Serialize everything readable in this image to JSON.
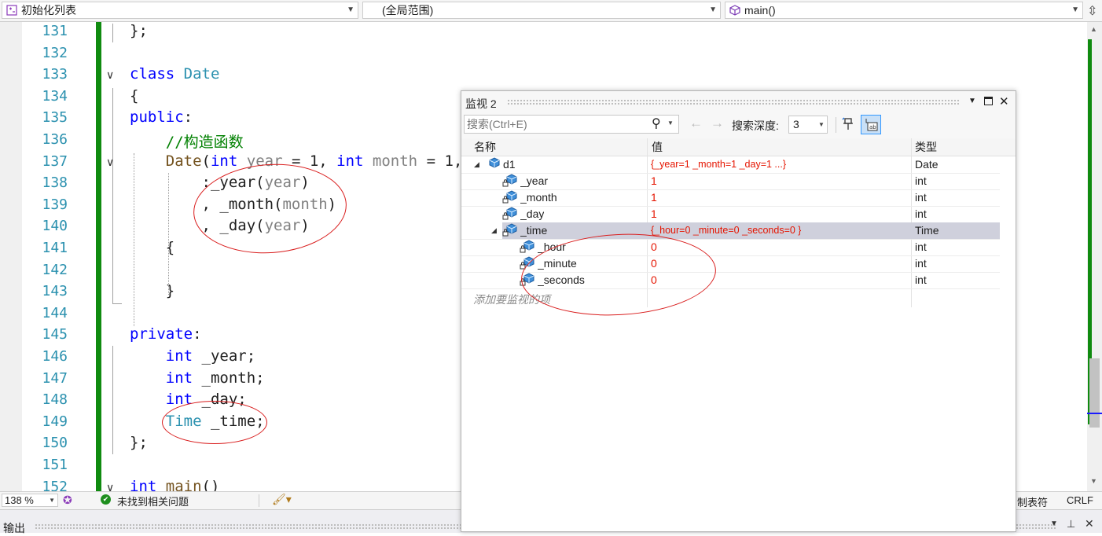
{
  "navbar": {
    "project": "初始化列表",
    "scope": "(全局范围)",
    "member": "main()"
  },
  "editor": {
    "lines": [
      {
        "num": "131",
        "segments": [
          {
            "t": "};",
            "c": ""
          }
        ]
      },
      {
        "num": "132",
        "segments": []
      },
      {
        "num": "133",
        "segments": [
          {
            "t": "class ",
            "c": "kw"
          },
          {
            "t": "Date",
            "c": "ty"
          }
        ]
      },
      {
        "num": "134",
        "segments": [
          {
            "t": "{",
            "c": ""
          }
        ]
      },
      {
        "num": "135",
        "segments": [
          {
            "t": "public",
            "c": "kw"
          },
          {
            "t": ":",
            "c": ""
          }
        ]
      },
      {
        "num": "136",
        "segments": [
          {
            "t": "    //构造函数",
            "c": "cm"
          }
        ]
      },
      {
        "num": "137",
        "segments": [
          {
            "t": "    ",
            "c": ""
          },
          {
            "t": "Date",
            "c": "fn"
          },
          {
            "t": "(",
            "c": ""
          },
          {
            "t": "int",
            "c": "kw"
          },
          {
            "t": " year",
            "c": "pm"
          },
          {
            "t": " = 1, ",
            "c": ""
          },
          {
            "t": "int",
            "c": "kw"
          },
          {
            "t": " month",
            "c": "pm"
          },
          {
            "t": " = 1,",
            "c": ""
          }
        ]
      },
      {
        "num": "138",
        "segments": [
          {
            "t": "        :_year(",
            "c": ""
          },
          {
            "t": "year",
            "c": "pm"
          },
          {
            "t": ")",
            "c": ""
          }
        ]
      },
      {
        "num": "139",
        "segments": [
          {
            "t": "        , _month(",
            "c": ""
          },
          {
            "t": "month",
            "c": "pm"
          },
          {
            "t": ")",
            "c": ""
          }
        ]
      },
      {
        "num": "140",
        "segments": [
          {
            "t": "        , _day(",
            "c": ""
          },
          {
            "t": "year",
            "c": "pm"
          },
          {
            "t": ")",
            "c": ""
          }
        ]
      },
      {
        "num": "141",
        "segments": [
          {
            "t": "    {",
            "c": ""
          }
        ]
      },
      {
        "num": "142",
        "segments": []
      },
      {
        "num": "143",
        "segments": [
          {
            "t": "    }",
            "c": ""
          }
        ]
      },
      {
        "num": "144",
        "segments": []
      },
      {
        "num": "145",
        "segments": [
          {
            "t": "private",
            "c": "kw"
          },
          {
            "t": ":",
            "c": ""
          }
        ]
      },
      {
        "num": "146",
        "segments": [
          {
            "t": "    ",
            "c": ""
          },
          {
            "t": "int",
            "c": "kw"
          },
          {
            "t": " _year;",
            "c": ""
          }
        ]
      },
      {
        "num": "147",
        "segments": [
          {
            "t": "    ",
            "c": ""
          },
          {
            "t": "int",
            "c": "kw"
          },
          {
            "t": " _month;",
            "c": ""
          }
        ]
      },
      {
        "num": "148",
        "segments": [
          {
            "t": "    ",
            "c": ""
          },
          {
            "t": "int",
            "c": "kw"
          },
          {
            "t": " _day;",
            "c": ""
          }
        ]
      },
      {
        "num": "149",
        "segments": [
          {
            "t": "    ",
            "c": ""
          },
          {
            "t": "Time",
            "c": "ty"
          },
          {
            "t": " _time;",
            "c": ""
          }
        ]
      },
      {
        "num": "150",
        "segments": [
          {
            "t": "};",
            "c": ""
          }
        ]
      },
      {
        "num": "151",
        "segments": []
      },
      {
        "num": "152",
        "segments": [
          {
            "t": "int",
            "c": "kw"
          },
          {
            "t": " ",
            "c": ""
          },
          {
            "t": "main",
            "c": "fn"
          },
          {
            "t": "()",
            "c": ""
          }
        ]
      }
    ]
  },
  "statusbar": {
    "zoom": "138 %",
    "issues": "未找到相关问题",
    "tabs_label": "制表符",
    "line_ending": "CRLF"
  },
  "output_panel": {
    "title": "输出"
  },
  "watch": {
    "title": "监视 2",
    "search_placeholder": "搜索(Ctrl+E)",
    "depth_label": "搜索深度:",
    "depth_value": "3",
    "columns": {
      "name": "名称",
      "value": "值",
      "type": "类型"
    },
    "rows": [
      {
        "name": "d1",
        "value": "{_year=1 _month=1 _day=1 ...}",
        "type": "Date"
      },
      {
        "name": "_year",
        "value": "1",
        "type": "int"
      },
      {
        "name": "_month",
        "value": "1",
        "type": "int"
      },
      {
        "name": "_day",
        "value": "1",
        "type": "int"
      },
      {
        "name": "_time",
        "value": "{_hour=0 _minute=0 _seconds=0 }",
        "type": "Time"
      },
      {
        "name": "_hour",
        "value": "0",
        "type": "int"
      },
      {
        "name": "_minute",
        "value": "0",
        "type": "int"
      },
      {
        "name": "_seconds",
        "value": "0",
        "type": "int"
      }
    ],
    "add_watch": "添加要监视的项"
  }
}
